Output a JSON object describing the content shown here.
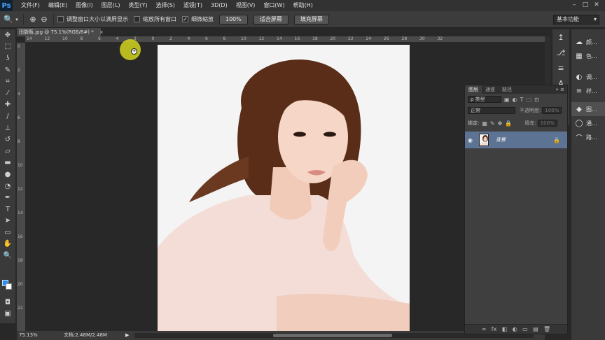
{
  "app": {
    "logo": "Ps"
  },
  "menu": [
    "文件(F)",
    "编辑(E)",
    "图像(I)",
    "图层(L)",
    "类型(Y)",
    "选择(S)",
    "滤镜(T)",
    "3D(D)",
    "视图(V)",
    "窗口(W)",
    "帮助(H)"
  ],
  "window_controls": {
    "minimize": "–",
    "maximize": "□",
    "close": "✕"
  },
  "options": {
    "resize_windows_label": "调整窗口大小以满屏显示",
    "zoom_all_label": "缩放所有窗口",
    "scrubby_zoom_label": "细微缩放",
    "scrubby_zoom_checked": "✓",
    "btn_100": "100%",
    "btn_fit": "适合屏幕",
    "btn_fill": "填充屏幕",
    "workspace": "基本功能"
  },
  "document": {
    "tab_title": "田馥甄.jpg @ 75.1%(RGB/8#) *",
    "tab_close": "×"
  },
  "ruler_h": [
    "14",
    "12",
    "10",
    "8",
    "6",
    "4",
    "2",
    "0",
    "2",
    "4",
    "6",
    "8",
    "10",
    "12",
    "14",
    "16",
    "18",
    "20",
    "22",
    "24",
    "26",
    "28",
    "30",
    "32"
  ],
  "ruler_v": [
    "0",
    "2",
    "4",
    "6",
    "8",
    "10",
    "12",
    "14",
    "16",
    "18",
    "20",
    "22"
  ],
  "status": {
    "zoom": "75.13%",
    "doc": "文档:2.48M/2.48M",
    "arrow": "▶"
  },
  "layers": {
    "tabs": [
      "图层",
      "通道",
      "路径"
    ],
    "menu": "» ≡",
    "filter_kind": "ρ 类型",
    "blend_mode": "正常",
    "opacity_label": "不透明度:",
    "opacity_value": "100%",
    "lock_label": "锁定:",
    "fill_label": "填充:",
    "fill_value": "100%",
    "layer_name": "背景",
    "eye": "◉",
    "lock": "🔒",
    "bottom_icons": [
      "∞",
      "fx",
      "◧",
      "◐",
      "▭",
      "▤",
      "🗑"
    ]
  },
  "dock": {
    "items": [
      {
        "icon": "☁",
        "label": "颜..."
      },
      {
        "icon": "▦",
        "label": "色..."
      },
      {
        "icon": "◐",
        "label": "调..."
      },
      {
        "icon": "≡",
        "label": "样..."
      },
      {
        "icon": "◆",
        "label": "图..."
      },
      {
        "icon": "◯",
        "label": "通..."
      },
      {
        "icon": "⌒",
        "label": "路..."
      }
    ]
  },
  "mini_strip": [
    "↥",
    "⎇",
    "≡",
    "A",
    "¶"
  ],
  "colors": {
    "foreground": "#1e90ff",
    "background": "#ffffff",
    "layer_selected": "#5d7393"
  }
}
